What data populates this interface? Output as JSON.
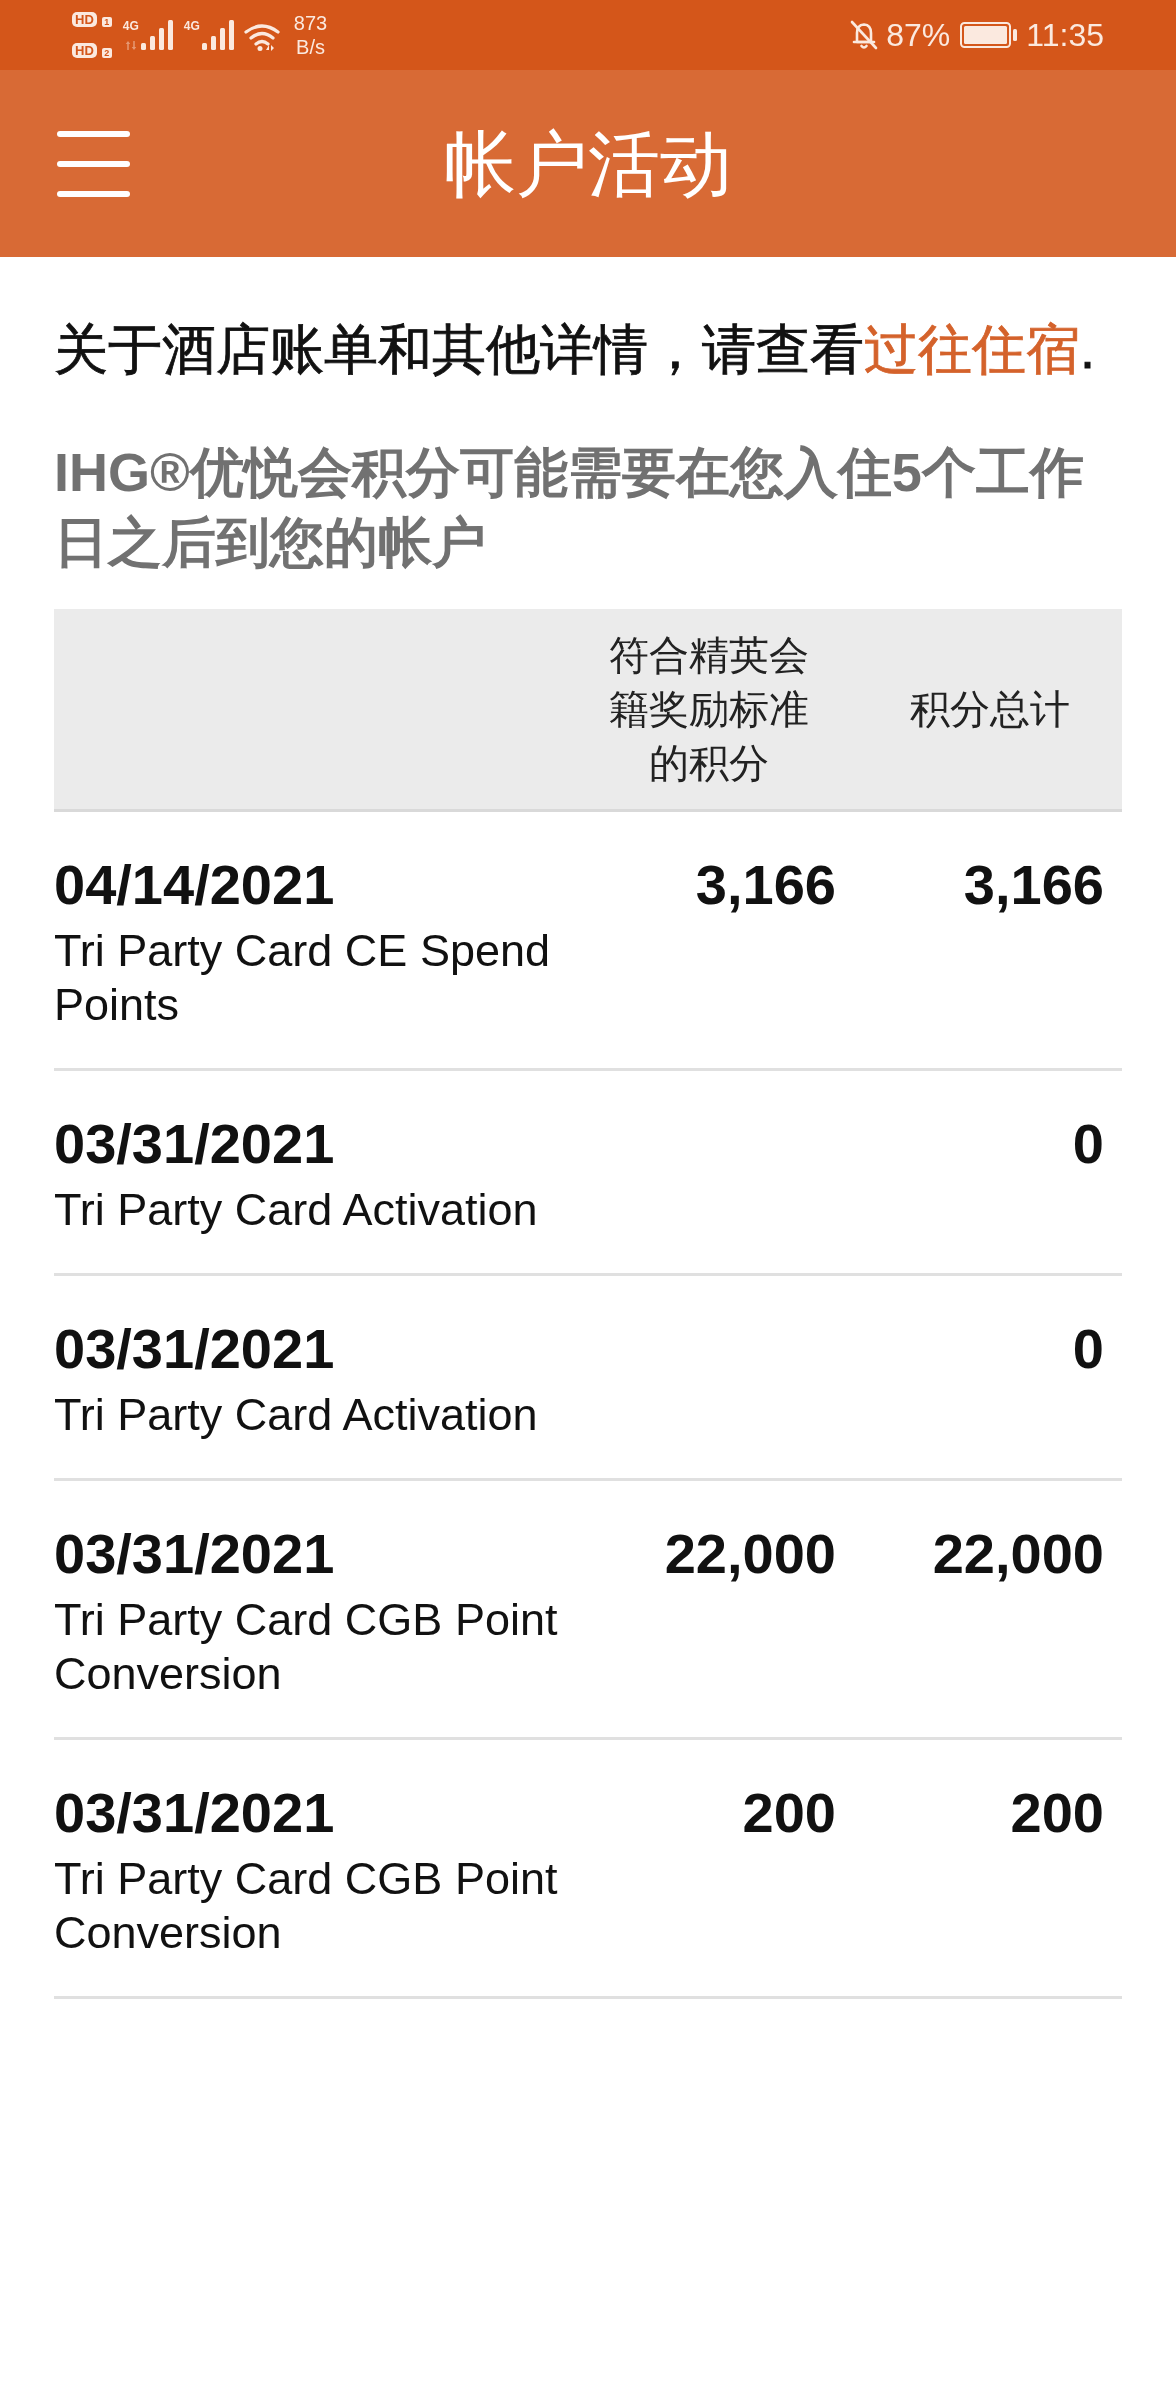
{
  "status_bar": {
    "sim_badges": [
      {
        "label": "HD",
        "slot": "1"
      },
      {
        "label": "HD",
        "slot": "2"
      }
    ],
    "signals": [
      {
        "network": "4G",
        "data_activity": true
      },
      {
        "network": "4G",
        "data_activity": false
      }
    ],
    "net_speed": {
      "value": "873",
      "unit": "B/s"
    },
    "battery": "87%",
    "time": "11:35"
  },
  "app_bar": {
    "title": "帐户活动"
  },
  "notice": {
    "text": "关于酒店账单和其他详情，请查看",
    "link": "过往住宿",
    "end": "."
  },
  "points_note": "IHG®优悦会积分可能需要在您入住5个工作日之后到您的帐户",
  "table": {
    "columns": [
      {
        "label": "符合精英会籍奖励标准的积分"
      },
      {
        "label": "积分总计"
      }
    ],
    "rows": [
      {
        "date": "04/14/2021",
        "description": "Tri Party Card CE Spend Points",
        "elite_points": "3,166",
        "total_points": "3,166"
      },
      {
        "date": "03/31/2021",
        "description": "Tri Party Card Activation",
        "total_points": "0"
      },
      {
        "date": "03/31/2021",
        "description": "Tri Party Card Activation",
        "total_points": "0"
      },
      {
        "date": "03/31/2021",
        "description": "Tri Party Card CGB Point Conversion",
        "elite_points": "22,000",
        "total_points": "22,000"
      },
      {
        "date": "03/31/2021",
        "description": "Tri Party Card CGB Point Conversion",
        "elite_points": "200",
        "total_points": "200"
      }
    ]
  }
}
